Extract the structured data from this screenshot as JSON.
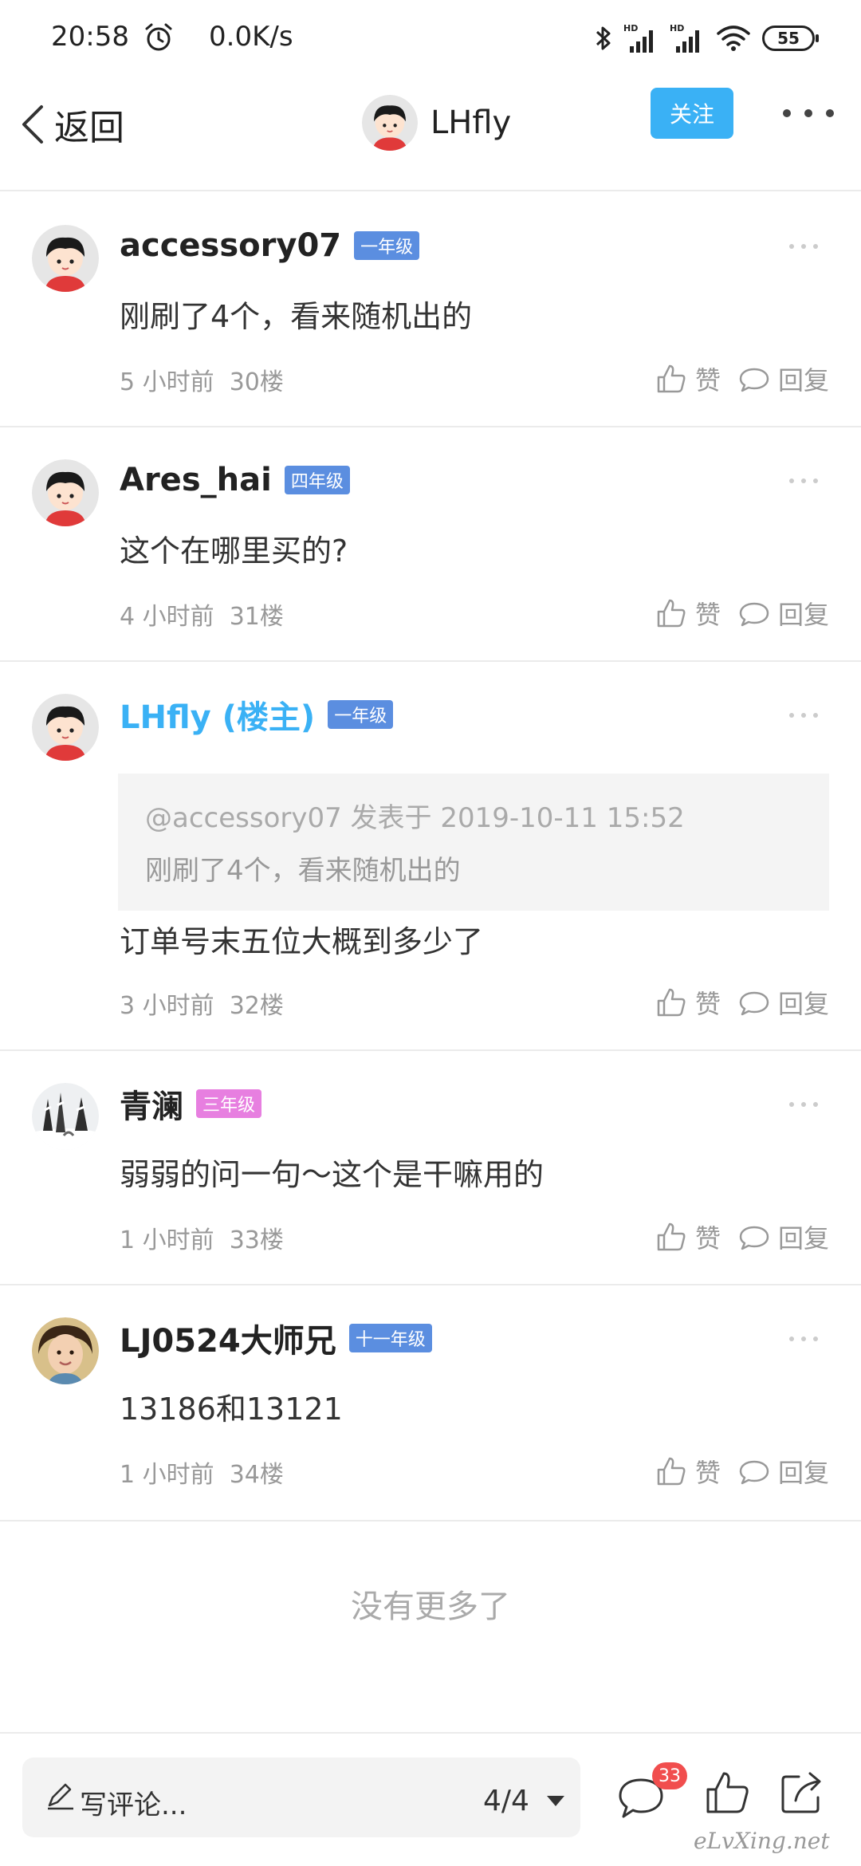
{
  "status_bar": {
    "time": "20:58",
    "net_speed": "0.0K/s",
    "battery": "55"
  },
  "nav": {
    "back_label": "返回",
    "username": "LHfly",
    "follow_label": "关注"
  },
  "comments": [
    {
      "username": "accessory07",
      "level": "一年级",
      "level_color": "#5b8ee0",
      "text": "刚刷了4个，看来随机出的",
      "time": "5 小时前",
      "floor": "30楼",
      "like_label": "赞",
      "reply_label": "回复"
    },
    {
      "username": "Ares_hai",
      "level": "四年级",
      "level_color": "#5b8ee0",
      "text": "这个在哪里买的?",
      "time": "4 小时前",
      "floor": "31楼",
      "like_label": "赞",
      "reply_label": "回复"
    },
    {
      "username": "LHfly (楼主)",
      "level": "一年级",
      "level_color": "#5b8ee0",
      "quote_head": "@accessory07 发表于 2019-10-11 15:52",
      "quote_body": "刚刷了4个，看来随机出的",
      "text": "订单号末五位大概到多少了",
      "time": "3 小时前",
      "floor": "32楼",
      "like_label": "赞",
      "reply_label": "回复"
    },
    {
      "username": "青澜",
      "level": "三年级",
      "level_color": "#e77fe0",
      "text": "弱弱的问一句～这个是干嘛用的",
      "time": "1 小时前",
      "floor": "33楼",
      "like_label": "赞",
      "reply_label": "回复"
    },
    {
      "username": "LJ0524大师兄",
      "level": "十一年级",
      "level_color": "#5b8ee0",
      "text": "13186和13121",
      "time": "1 小时前",
      "floor": "34楼",
      "like_label": "赞",
      "reply_label": "回复"
    }
  ],
  "no_more": "没有更多了",
  "bottom": {
    "input_placeholder": "写评论...",
    "page_indicator": "4/4",
    "comment_badge": "33"
  },
  "watermark": "eLvXing.net",
  "colors": {
    "accent": "#3ab1f5",
    "badge_red": "#f14e4e"
  }
}
